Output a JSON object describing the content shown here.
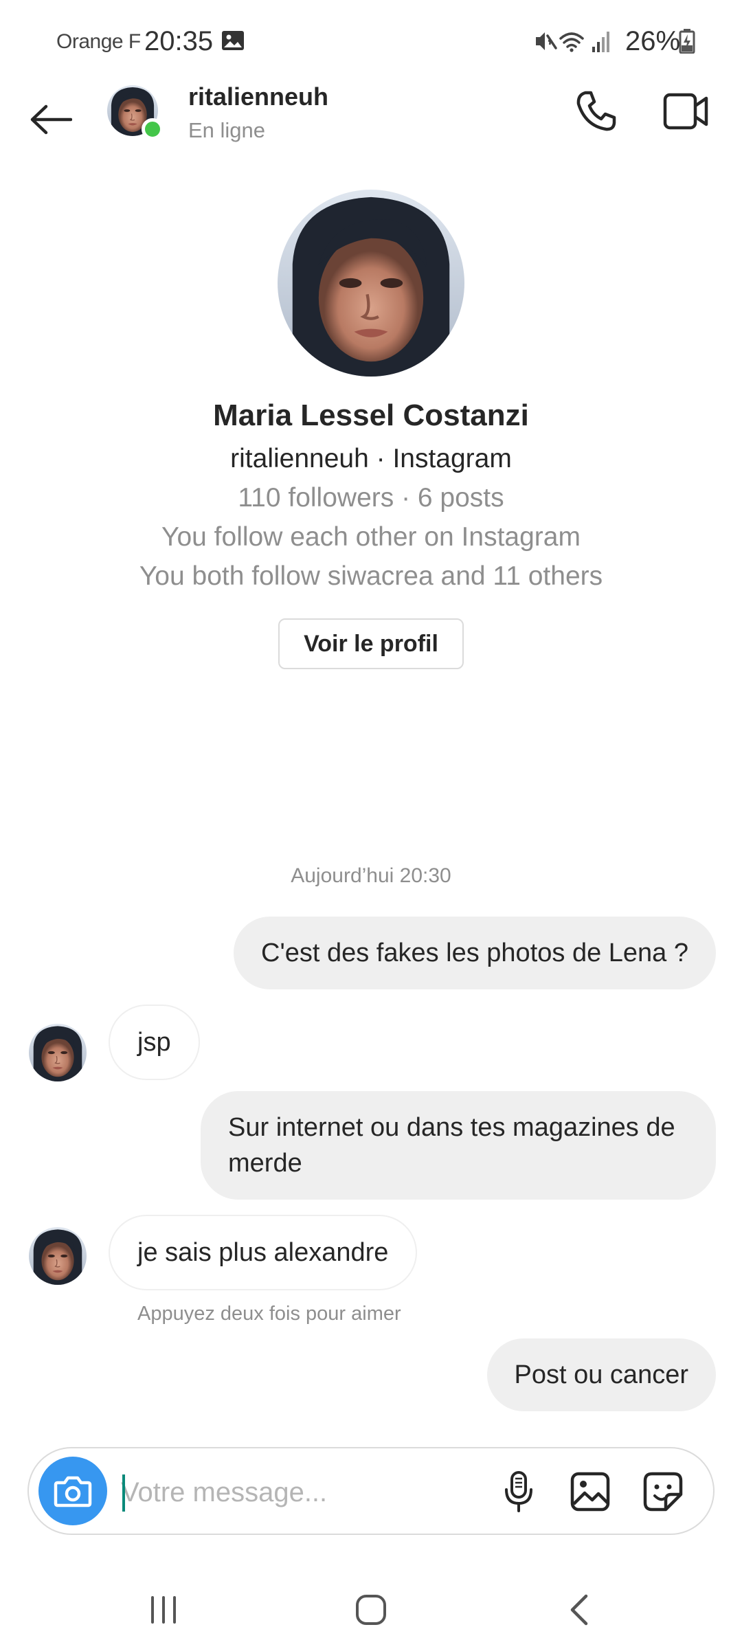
{
  "status_bar": {
    "carrier": "Orange F",
    "time": "20:35",
    "battery": "26%",
    "icons": [
      "gallery-notification-icon",
      "mute-icon",
      "wifi-icon",
      "signal-icon",
      "battery-charging-icon"
    ]
  },
  "header": {
    "username": "ritalienneuh",
    "status": "En ligne",
    "icons": [
      "back-arrow-icon",
      "phone-icon",
      "video-camera-icon"
    ],
    "online_color": "#44c64a"
  },
  "profile": {
    "name": "Maria Lessel Costanzi",
    "handle": "ritalienneuh · Instagram",
    "stats": "110 followers · 6 posts",
    "mutual": "You follow each other on Instagram",
    "follow_info": "You both follow siwacrea and 11 others",
    "view_profile_label": "Voir le profil"
  },
  "conversation": {
    "timestamp": "Aujourd’hui 20:30",
    "messages": [
      {
        "from": "me",
        "text": "C'est des fakes les photos de Lena ?"
      },
      {
        "from": "them",
        "text": "jsp"
      },
      {
        "from": "me",
        "text": "Sur internet ou dans tes magazines de merde"
      },
      {
        "from": "them",
        "text": "je sais plus alexandre"
      },
      {
        "from": "me",
        "text": "Post ou cancer"
      }
    ],
    "like_hint": "Appuyez deux fois pour aimer"
  },
  "composer": {
    "placeholder": "Votre message...",
    "icons": [
      "camera-icon",
      "microphone-icon",
      "image-icon",
      "sticker-icon"
    ],
    "camera_color": "#3797f0"
  },
  "navbar": {
    "icons": [
      "recent-apps-icon",
      "home-icon",
      "back-icon"
    ]
  }
}
